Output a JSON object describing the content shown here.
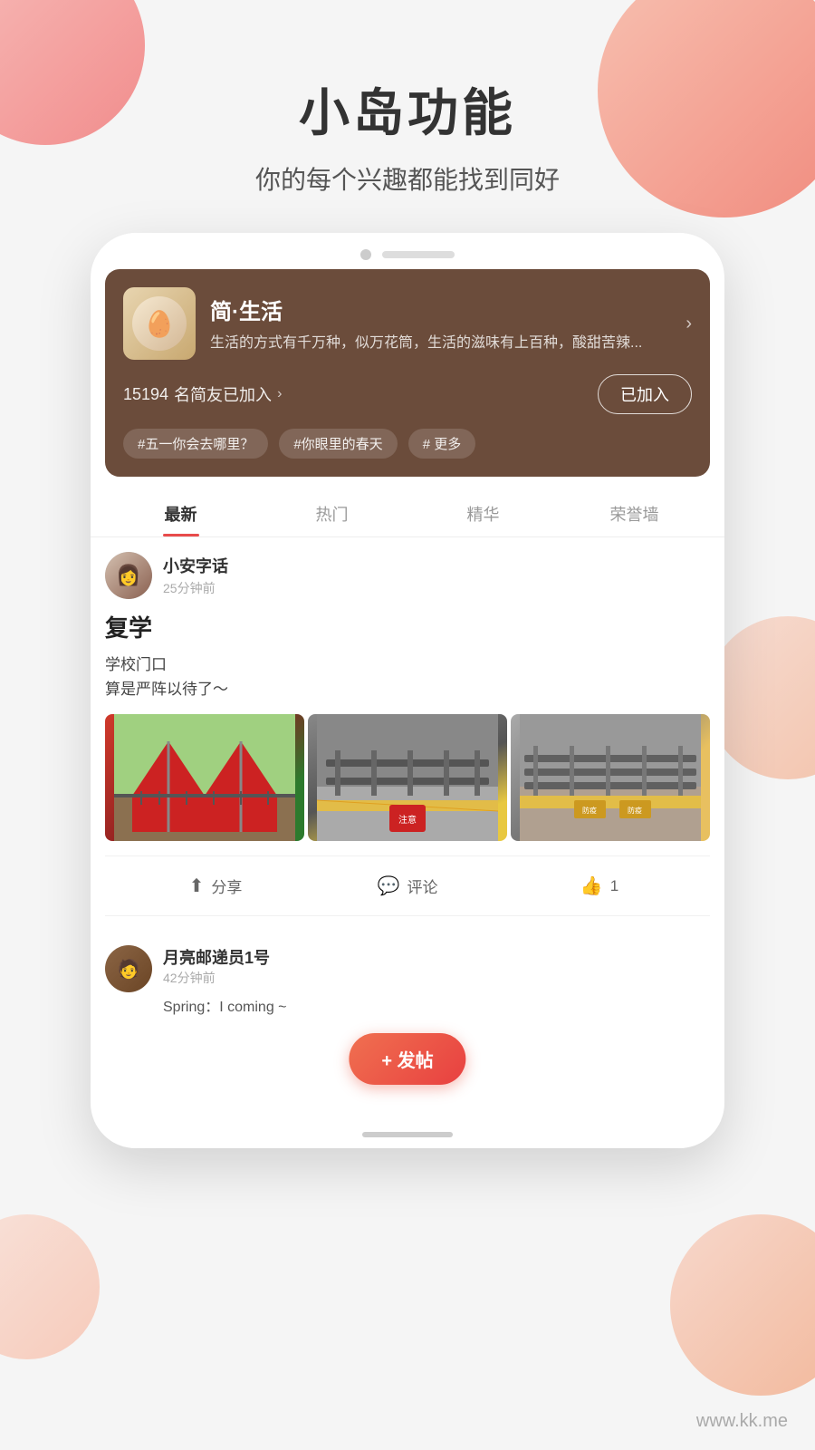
{
  "page": {
    "background_color": "#f5f5f5"
  },
  "header": {
    "main_title": "小岛功能",
    "sub_title": "你的每个兴趣都能找到同好"
  },
  "community_card": {
    "name": "简·生活",
    "description": "生活的方式有千万种，似万花筒，生活的滋味有上百种，酸甜苦辣...",
    "member_count": "15194",
    "member_label": "名简友已加入",
    "join_button_label": "已加入",
    "tags": [
      "#五一你会去哪里？",
      "#你眼里的春天",
      "#  更多"
    ]
  },
  "tabs": [
    {
      "label": "最新",
      "active": true
    },
    {
      "label": "热门",
      "active": false
    },
    {
      "label": "精华",
      "active": false
    },
    {
      "label": "荣誉墙",
      "active": false
    }
  ],
  "post1": {
    "username": "小安字话",
    "time": "25分钟前",
    "title": "复学",
    "content_line1": "学校门口",
    "content_line2": "算是严阵以待了～",
    "images": [
      "tent_image",
      "fence_image_1",
      "fence_image_2"
    ]
  },
  "action_bar": {
    "share_label": "分享",
    "comment_label": "评论",
    "like_label": "1"
  },
  "post2": {
    "username": "月亮邮递员1号",
    "time": "42分钟前",
    "preview": "Spring：I coming ~"
  },
  "fab": {
    "label": "+ 发帖"
  },
  "watermark": {
    "text": "www.kk.me"
  }
}
